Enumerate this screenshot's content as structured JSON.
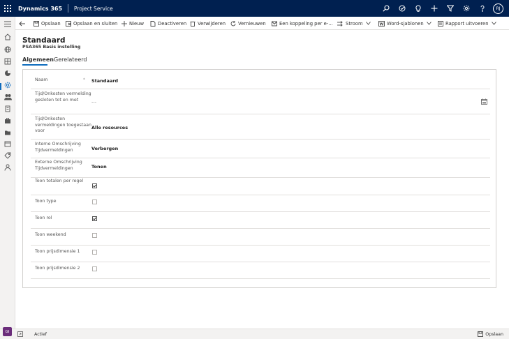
{
  "header": {
    "app_name": "Dynamics 365",
    "module": "Project Service",
    "avatar_initials": "RJ"
  },
  "commands": {
    "back_icon": "back-arrow-icon",
    "save": "Opslaan",
    "save_close": "Opslaan en sluiten",
    "new": "Nieuw",
    "deactivate": "Deactiveren",
    "delete": "Verwijderen",
    "refresh": "Vernieuwen",
    "email_link": "Een koppeling per e-...",
    "flow": "Stroom",
    "word_templates": "Word-sjablonen",
    "run_report": "Rapport uitvoeren"
  },
  "form": {
    "title": "Standaard",
    "subtitle": "PSA365 Basis instelling",
    "tabs": [
      "Algemeen",
      "Gerelateerd"
    ],
    "active_tab": 0,
    "required_marker": "*",
    "fields": [
      {
        "label": "Naam",
        "value": "Standaard"
      },
      {
        "label": "Tijd/Onkosten vermelding gesloten tot en met",
        "value": "---"
      },
      {
        "label": "Tijd/Onkosten vermeldingen toegestaan voor",
        "value": "Alle resources"
      },
      {
        "label": "Interne Omschrijving Tijdvermeldingen",
        "value": "Verbergen"
      },
      {
        "label": "Externe Omschrijving Tijdvermeldingen",
        "value": "Tonen"
      },
      {
        "label": "Toon totalen per regel",
        "checked": true
      },
      {
        "label": "Toon type",
        "checked": false
      },
      {
        "label": "Toon rol",
        "checked": true
      },
      {
        "label": "Toon weekend",
        "checked": false
      },
      {
        "label": "Toon prijsdimensie 1",
        "checked": false
      },
      {
        "label": "Toon prijsdimensie 2",
        "checked": false
      }
    ]
  },
  "status_bar": {
    "badge": "GI",
    "status": "Actief",
    "save_label": "Opslaan"
  },
  "colors": {
    "topbar": "#002050",
    "accent": "#0f6cbd",
    "badge": "#6b2d7b"
  }
}
